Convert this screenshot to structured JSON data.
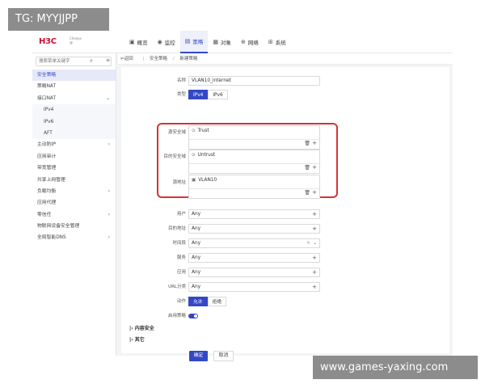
{
  "watermarks": {
    "top": "TG: MYYJJPP",
    "bottom": "www.games-yaxing.com"
  },
  "brand": {
    "logo": "H3C",
    "sub1": "Cheeps",
    "sub2": "@"
  },
  "topnav": [
    {
      "label": "概览",
      "icon": "dashboard-icon",
      "glyph": "▣"
    },
    {
      "label": "监控",
      "icon": "monitor-icon",
      "glyph": "◉"
    },
    {
      "label": "策略",
      "icon": "policy-icon",
      "glyph": "▤"
    },
    {
      "label": "对象",
      "icon": "object-icon",
      "glyph": "▦"
    },
    {
      "label": "网络",
      "icon": "network-icon",
      "glyph": "⊕"
    },
    {
      "label": "系统",
      "icon": "system-icon",
      "glyph": "⊞"
    }
  ],
  "sidebar": {
    "search_placeholder": "搜索菜单关键字",
    "items": [
      {
        "label": "安全策略"
      },
      {
        "label": "策略NAT"
      },
      {
        "label": "接口NAT",
        "chev": "⌄"
      },
      {
        "label": "IPv4"
      },
      {
        "label": "IPv6"
      },
      {
        "label": "AFT"
      },
      {
        "label": "主动防护",
        "chev": "›"
      },
      {
        "label": "应用审计"
      },
      {
        "label": "带宽管理"
      },
      {
        "label": "共享上网管理"
      },
      {
        "label": "负载均衡",
        "chev": "›"
      },
      {
        "label": "应用代理"
      },
      {
        "label": "零信任",
        "chev": "›"
      },
      {
        "label": "物联网设备安全管理"
      },
      {
        "label": "全局智能DNS",
        "chev": "›"
      }
    ]
  },
  "breadcrumb": {
    "back": "返回",
    "parent": "安全策略",
    "current": "新建策略",
    "sep": "|",
    "sep2": "/"
  },
  "form": {
    "name_label": "名称",
    "name_value": "VLAN10_Internet",
    "type_label": "类型",
    "type_options": [
      "IPv4",
      "IPv6"
    ],
    "src_zone_label": "源安全域",
    "src_zone_value": "Trust",
    "dst_zone_label": "目的安全域",
    "dst_zone_value": "Untrust",
    "src_addr_label": "源地址",
    "src_addr_value": "VLAN10",
    "user_label": "用户",
    "user_value": "Any",
    "dst_addr_label": "目的地址",
    "dst_addr_value": "Any",
    "time_label": "时间段",
    "time_value": "Any",
    "service_label": "服务",
    "service_value": "Any",
    "app_label": "应用",
    "app_value": "Any",
    "url_label": "URL分类",
    "url_value": "Any",
    "action_label": "动作",
    "action_options": [
      "允许",
      "拒绝"
    ],
    "enable_label": "启用策略"
  },
  "sections": {
    "content_security": "内容安全",
    "other": "其它"
  },
  "buttons": {
    "ok": "确定",
    "cancel": "取消"
  },
  "colors": {
    "accent": "#3548c4",
    "highlight": "#d93131",
    "brand": "#c8102e"
  }
}
